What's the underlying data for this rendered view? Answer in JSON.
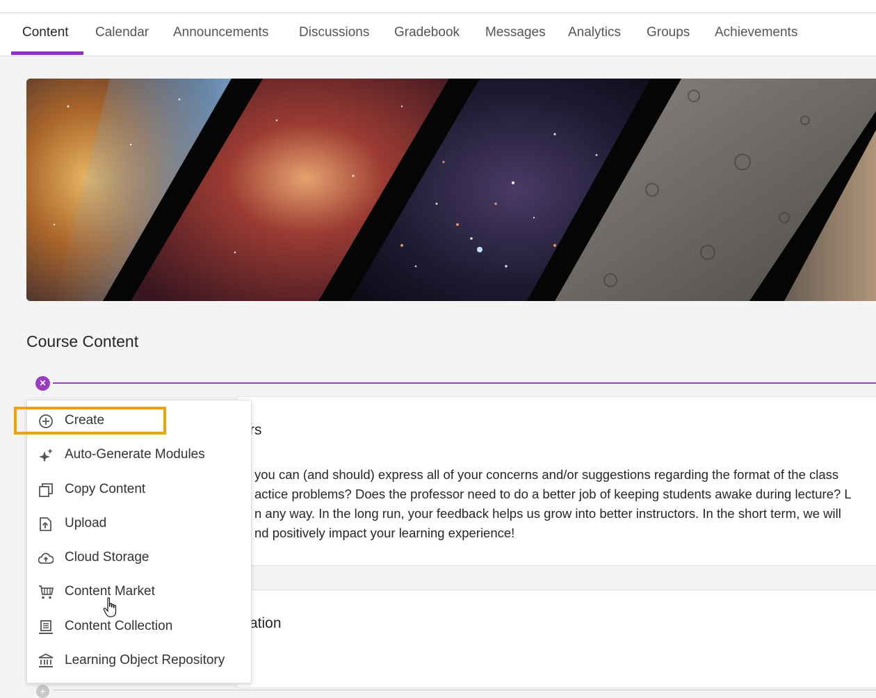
{
  "tabs": [
    {
      "label": "Content",
      "active": true
    },
    {
      "label": "Calendar"
    },
    {
      "label": "Announcements"
    },
    {
      "label": "Discussions"
    },
    {
      "label": "Gradebook"
    },
    {
      "label": "Messages"
    },
    {
      "label": "Analytics"
    },
    {
      "label": "Groups"
    },
    {
      "label": "Achievements"
    }
  ],
  "section_title": "Course Content",
  "add_button_icon": "close-icon",
  "menu": {
    "items": [
      {
        "label": "Create",
        "icon": "plus-circle-icon",
        "highlighted": true
      },
      {
        "label": "Auto-Generate Modules",
        "icon": "sparkle-icon"
      },
      {
        "label": "Copy Content",
        "icon": "copy-icon"
      },
      {
        "label": "Upload",
        "icon": "upload-icon"
      },
      {
        "label": "Cloud Storage",
        "icon": "cloud-upload-icon"
      },
      {
        "label": "Content Market",
        "icon": "cart-icon"
      },
      {
        "label": "Content Collection",
        "icon": "collection-icon"
      },
      {
        "label": "Learning Object Repository",
        "icon": "institution-icon"
      }
    ]
  },
  "cards": {
    "first": {
      "title_fragment": "rs",
      "lines": [
        "you can (and should) express all of your concerns and/or suggestions regarding the format of the class",
        "actice problems? Does the professor need to do a better job of keeping students awake during lecture? L",
        "n any way. In the long run, your feedback helps us grow into better instructors. In the short term, we will",
        "nd positively impact your learning experience!"
      ]
    },
    "second": {
      "title_fragment": "ation"
    }
  },
  "colors": {
    "accent": "#8f32b8",
    "highlight": "#f1a006",
    "background": "#f4f4f4"
  }
}
